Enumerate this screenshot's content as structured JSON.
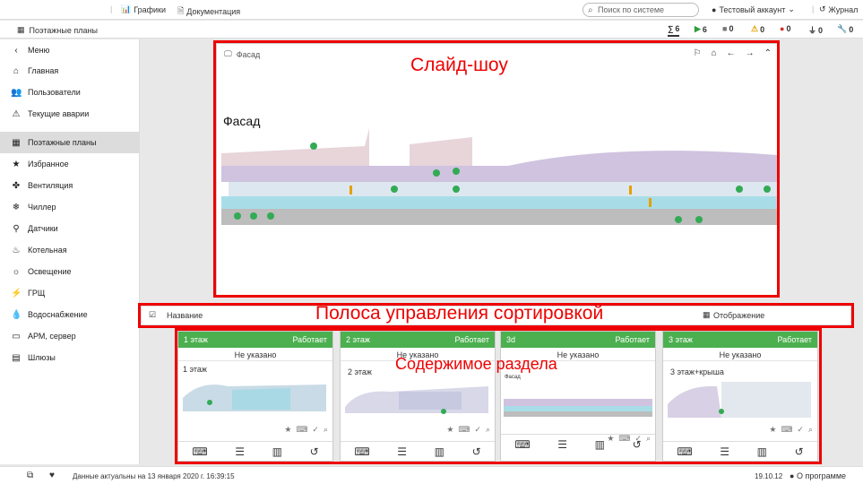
{
  "topbar": {
    "charts": "Графики",
    "docs": "Документация",
    "search_placeholder": "Поиск по системе",
    "account": "Тестовый аккаунт",
    "journal": "Журнал"
  },
  "breadcrumb": "Поэтажные планы",
  "counters": [
    {
      "icon": "∑",
      "value": "6",
      "color": "#333"
    },
    {
      "icon": "▶",
      "value": "6",
      "color": "#2e9e3e"
    },
    {
      "icon": "■",
      "value": "0",
      "color": "#777"
    },
    {
      "icon": "⚠",
      "value": "0",
      "color": "#e6a000"
    },
    {
      "icon": "●",
      "value": "0",
      "color": "#d32f2f"
    },
    {
      "icon": "⏚",
      "value": "0",
      "color": "#333"
    },
    {
      "icon": "🔧",
      "value": "0",
      "color": "#7b3fa0"
    }
  ],
  "sidebar": {
    "menu": "Меню",
    "items": [
      "Главная",
      "Пользователи",
      "Текущие аварии",
      "Поэтажные планы",
      "Избранное",
      "Вентиляция",
      "Чиллер",
      "Датчики",
      "Котельная",
      "Освещение",
      "ГРЩ",
      "Водоснабжение",
      "АРМ, сервер",
      "Шлюзы"
    ]
  },
  "slideshow": {
    "title": "Фасад",
    "heading": "Фасад"
  },
  "annotations": {
    "slideshow": "Слайд-шоу",
    "sortbar": "Полоса управления сортировкой",
    "content": "Содержимое раздела"
  },
  "sortbar": {
    "name": "Название",
    "display": "Отображение"
  },
  "cards": [
    {
      "title": "1 этаж",
      "status": "Работает",
      "sub": "Не указано",
      "label": "1 этаж"
    },
    {
      "title": "2 этаж",
      "status": "Работает",
      "sub": "Не указано",
      "label": "2 этаж"
    },
    {
      "title": "3d",
      "status": "Работает",
      "sub": "Не указано",
      "label": "Фасад"
    },
    {
      "title": "3 этаж",
      "status": "Работает",
      "sub": "Не указано",
      "label": "3 этаж+крыша"
    }
  ],
  "footer": {
    "status": "Данные актуальны на 13 января 2020 г. 16:39:15",
    "version": "19.10.12",
    "about": "О программе"
  }
}
